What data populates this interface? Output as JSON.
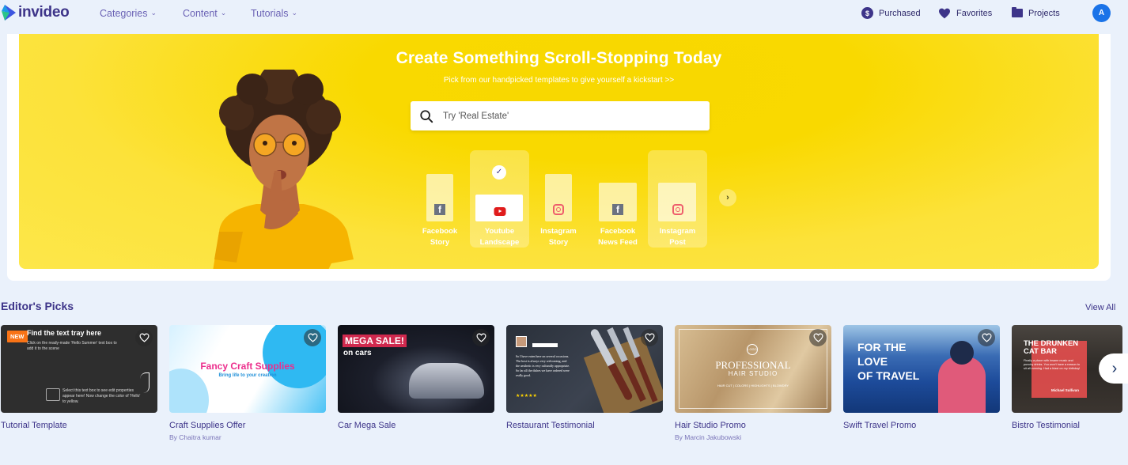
{
  "nav": {
    "brand": "invideo",
    "menu": [
      {
        "label": "Categories",
        "icon": "chevron-down-icon"
      },
      {
        "label": "Content",
        "icon": "chevron-down-icon"
      },
      {
        "label": "Tutorials",
        "icon": "chevron-down-icon"
      }
    ],
    "right": [
      {
        "label": "Purchased",
        "icon": "dollar-icon"
      },
      {
        "label": "Favorites",
        "icon": "heart-icon"
      },
      {
        "label": "Projects",
        "icon": "folder-icon"
      }
    ],
    "avatar_initial": "A"
  },
  "hero": {
    "title": "Create Something Scroll-Stopping Today",
    "subtitle": "Pick from our handpicked templates to give yourself a kickstart >>",
    "search_placeholder": "Try 'Real Estate'",
    "formats": [
      {
        "line1": "Facebook",
        "line2": "Story",
        "icon": "facebook-icon",
        "selected": false
      },
      {
        "line1": "Youtube",
        "line2": "Landscape",
        "icon": "youtube-icon",
        "selected": true
      },
      {
        "line1": "Instagram",
        "line2": "Story",
        "icon": "instagram-icon",
        "selected": false
      },
      {
        "line1": "Facebook",
        "line2": "News Feed",
        "icon": "facebook-icon",
        "selected": false
      },
      {
        "line1": "Instagram",
        "line2": "Post",
        "icon": "instagram-icon",
        "selected": false
      }
    ],
    "check_glyph": "✓",
    "next_glyph": "›"
  },
  "editors_picks": {
    "title": "Editor's Picks",
    "view_all": "View All",
    "templates": [
      {
        "name": "Tutorial Template",
        "author": "",
        "badge": "NEW",
        "thumb_text": [
          "Find the text tray here",
          "Click on the ready-made 'Hello Summer' text box to add it to the scene",
          "Select this text box to see edit properties appear here! Now change the color of 'Hello' to yellow."
        ]
      },
      {
        "name": "Craft Supplies Offer",
        "author": "By Chaitra kumar",
        "badge": "",
        "thumb_text": [
          "Fancy Craft Supplies",
          "Bring life to your creation"
        ]
      },
      {
        "name": "Car Mega Sale",
        "author": "",
        "badge": "",
        "thumb_text": [
          "MEGA SALE!",
          "on cars"
        ]
      },
      {
        "name": "Restaurant Testimonial",
        "author": "",
        "badge": "",
        "thumb_text": [
          "So I have eaten here on several occasions. The host is always very welcoming, and the aesthetic is very culturally appropriate. So far all the dishes we have ordered were really good.",
          "★★★★★"
        ]
      },
      {
        "name": "Hair Studio Promo",
        "author": "By Marcin Jakubowski",
        "badge": "",
        "thumb_text": [
          "LOGO",
          "PROFESSIONAL",
          "HAIR STUDIO",
          "HAIR CUT | COLORS | HIGHLIGHTS | BLOWDRY"
        ]
      },
      {
        "name": "Swift Travel Promo",
        "author": "",
        "badge": "",
        "thumb_text": [
          "FOR THE",
          "LOVE",
          "OF TRAVEL"
        ]
      },
      {
        "name": "Bistro Testimonial",
        "author": "",
        "badge": "",
        "thumb_text": [
          "THE DRUNKEN",
          "CAT BAR",
          "Finally a place with insane music and punchy drinks. You won't have a reason to sit all evening. Had a blast on my birthday!",
          "Michael Sullivan"
        ]
      }
    ],
    "next_glyph": "›"
  },
  "colors": {
    "brand": "#3d3489",
    "hero_yellow": "#f9d900",
    "avatar": "#1a73e8",
    "badge": "#f97316",
    "page_bg": "#eaf1fb"
  }
}
